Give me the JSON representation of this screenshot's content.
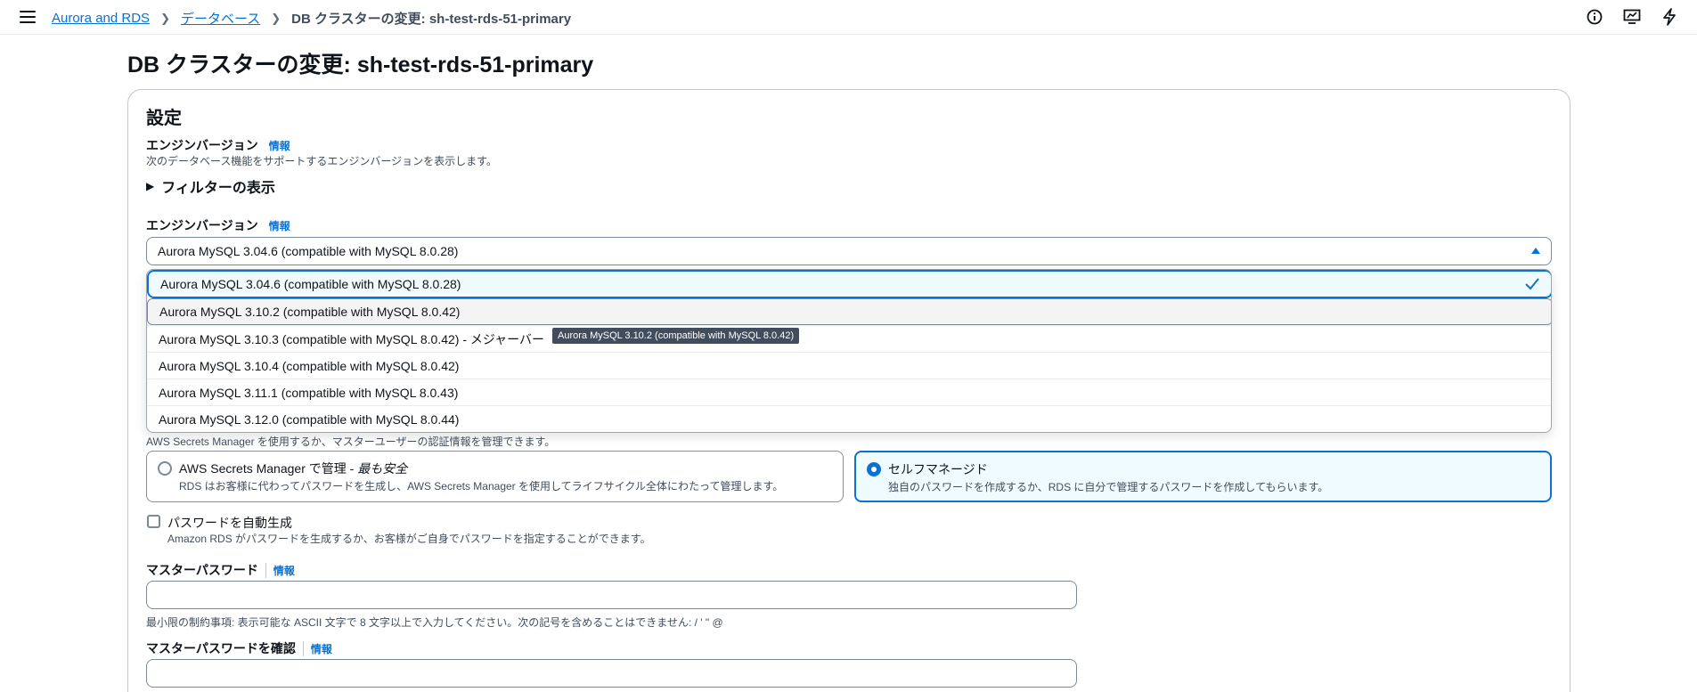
{
  "breadcrumb": {
    "items": [
      "Aurora and RDS",
      "データベース"
    ],
    "current": "DB クラスターの変更: sh-test-rds-51-primary"
  },
  "page": {
    "title": "DB クラスターの変更: sh-test-rds-51-primary"
  },
  "settings": {
    "title": "設定",
    "engine_version_section_label": "エンジンバージョン",
    "info": "情報",
    "engine_version_section_desc": "次のデータベース機能をサポートするエンジンバージョンを表示します。",
    "filter_toggle": "フィルターの表示",
    "engine_version_label": "エンジンバージョン",
    "selected_version": "Aurora MySQL 3.04.6 (compatible with MySQL 8.0.28)",
    "options": [
      "Aurora MySQL 3.04.6 (compatible with MySQL 8.0.28)",
      "Aurora MySQL 3.10.2 (compatible with MySQL 8.0.42)",
      "Aurora MySQL 3.10.3 (compatible with MySQL 8.0.42) - メジャーバー",
      "Aurora MySQL 3.10.4 (compatible with MySQL 8.0.42)",
      "Aurora MySQL 3.11.1 (compatible with MySQL 8.0.43)",
      "Aurora MySQL 3.12.0 (compatible with MySQL 8.0.44)"
    ],
    "tooltip": "Aurora MySQL 3.10.2 (compatible with MySQL 8.0.42)"
  },
  "credentials": {
    "desc": "AWS Secrets Manager を使用するか、マスターユーザーの認証情報を管理できます。",
    "secrets_title": "AWS Secrets Manager で管理 - ",
    "secrets_title_em": "最も安全",
    "secrets_desc": "RDS はお客様に代わってパスワードを生成し、AWS Secrets Manager を使用してライフサイクル全体にわたって管理します。",
    "self_title": "セルフマネージド",
    "self_desc": "独自のパスワードを作成するか、RDS に自分で管理するパスワードを作成してもらいます。",
    "autogen_label": "パスワードを自動生成",
    "autogen_desc": "Amazon RDS がパスワードを生成するか、お客様がご自身でパスワードを指定することができます。",
    "master_password_label": "マスターパスワード",
    "master_password_value": "",
    "password_constraint": "最小限の制約事項: 表示可能な ASCII 文字で 8 文字以上で入力してください。次の記号を含めることはできません: / ' \" @",
    "confirm_password_label": "マスターパスワードを確認",
    "confirm_password_value": ""
  },
  "colors": {
    "accent": "#0972d3",
    "text": "#0f141a",
    "muted": "#414d5c"
  }
}
